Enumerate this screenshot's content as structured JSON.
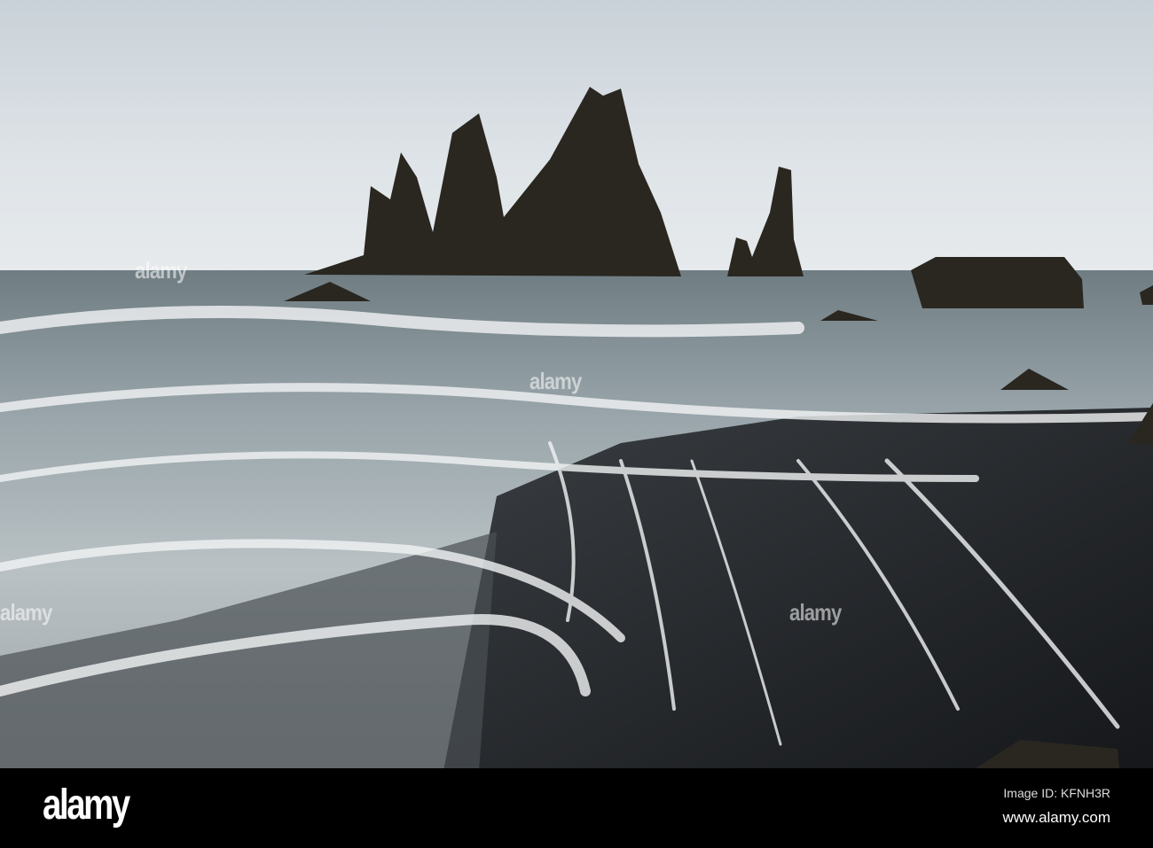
{
  "watermark": {
    "text": "alamy"
  },
  "footer": {
    "logo": "alamy",
    "image_id": "Image ID: KFNH3R",
    "website": "www.alamy.com"
  },
  "colors": {
    "sky": "#d9dfe4",
    "sea": "#7d8a90",
    "foam": "#e8ecee",
    "beach": "#1f2124",
    "rock": "#2a2720"
  }
}
